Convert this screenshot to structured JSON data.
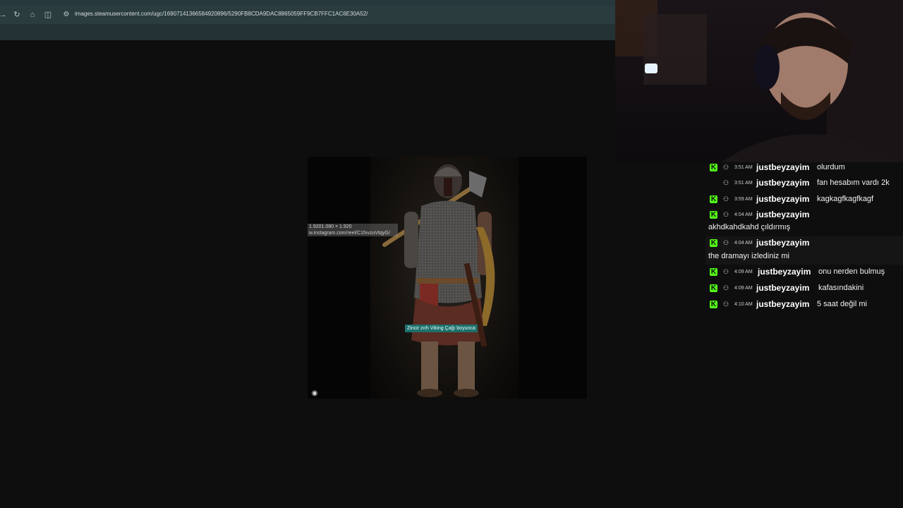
{
  "browser": {
    "url": "images.steamusercontent.com/ugc/16907141366584920896/5290FB8CDA9DAC8865059FF9CB7FFC1AC6E30A52/",
    "icons": {
      "back": "back-arrow-icon",
      "reload": "reload-icon",
      "home": "home-icon",
      "sidebar": "split-view-icon",
      "site_info": "site-info-icon"
    }
  },
  "image": {
    "overlay_dims": "1.9201.080 × 1.920",
    "overlay_source": "w.instagram.com/reel/C1fxvzuVtqyG/",
    "caption": "Zincir zırh Viking Çağı boyunca",
    "lens_icon": "google-lens-icon"
  },
  "chat": {
    "accent": "#53fc18",
    "messages": [
      {
        "time": "3:51 AM",
        "user": "justbeyzayim",
        "text": "olurdum",
        "badge": true
      },
      {
        "time": "3:51 AM",
        "user": "justbeyzayim",
        "text": "fan hesabım vardı 2k",
        "badge": false
      },
      {
        "time": "3:59 AM",
        "user": "justbeyzayim",
        "text": "kagkagfkagfkagf",
        "badge": true
      },
      {
        "time": "4:04 AM",
        "user": "justbeyzayim",
        "text": "akhdkahdkahd çıldırmış",
        "badge": true
      },
      {
        "time": "4:04 AM",
        "user": "justbeyzayim",
        "text": "the dramayı izlediniz mi",
        "badge": true
      },
      {
        "time": "4:09 AM",
        "user": "justbeyzayim",
        "text": "onu nerden bulmuş",
        "badge": true
      },
      {
        "time": "4:09 AM",
        "user": "justbeyzayim",
        "text": "kafasındakini",
        "badge": true
      },
      {
        "time": "4:10 AM",
        "user": "justbeyzayim",
        "text": "5 saat değil mi",
        "badge": true
      }
    ]
  }
}
